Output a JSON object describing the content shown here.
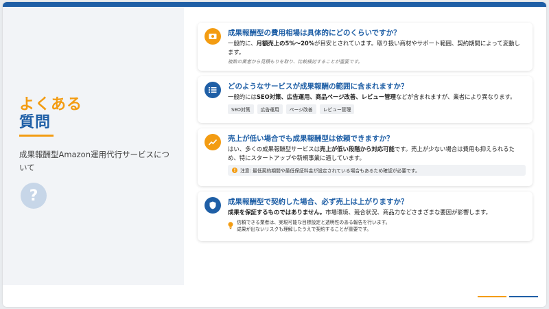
{
  "header": {
    "title_line1": "よくある",
    "title_line2": "質問",
    "subtitle": "成果報酬型Amazon運用代行サービスについて",
    "badge": "?"
  },
  "faq": [
    {
      "icon": "money-icon",
      "question": "成果報酬型の費用相場は具体的にどのくらいですか？",
      "answer_pre": "一般的に、",
      "answer_bold": "月額売上の5%〜20%",
      "answer_post": "が目安とされています。取り扱い商材やサポート範囲、契約期間によって変動します。",
      "note": "複数の業者から見積もりを取り、比較検討することが重要です。"
    },
    {
      "icon": "list-icon",
      "question": "どのようなサービスが成果報酬の範囲に含まれますか？",
      "answer_pre": "一般的には",
      "answer_bold": "SEO対策、広告運用、商品ページ改善、レビュー管理",
      "answer_post": "などが含まれますが、業者により異なります。",
      "tags": [
        "SEO対策",
        "広告運用",
        "ページ改善",
        "レビュー管理"
      ]
    },
    {
      "icon": "chart-icon",
      "question": "売上が低い場合でも成果報酬型は依頼できますか？",
      "answer_pre": "はい、多くの成果報酬型サービスは",
      "answer_bold": "売上が低い段階から対応可能",
      "answer_post": "です。売上が少ない場合は費用も抑えられるため、特にスタートアップや新規事業に適しています。",
      "notice": "注意: 最低契約期間や最低保証料金が設定されている場合もあるため確認が必要です。"
    },
    {
      "icon": "shield-icon",
      "question": "成果報酬型で契約した場合、必ず売上は上がりますか？",
      "answer_bold": "成果を保証するものではありません。",
      "answer_post": "市場環境、競合状況、商品力などさまざまな要因が影響します。",
      "tip_line1": "信頼できる業者は、実現可能な目標設定と透明性のある報告を行います。",
      "tip_line2": "成果が出ないリスクも理解したうえで契約することが重要です。"
    }
  ],
  "colors": {
    "accent_orange": "#f39c12",
    "brand_blue": "#1f5fa6",
    "panel_bg": "#f2f4f7"
  }
}
